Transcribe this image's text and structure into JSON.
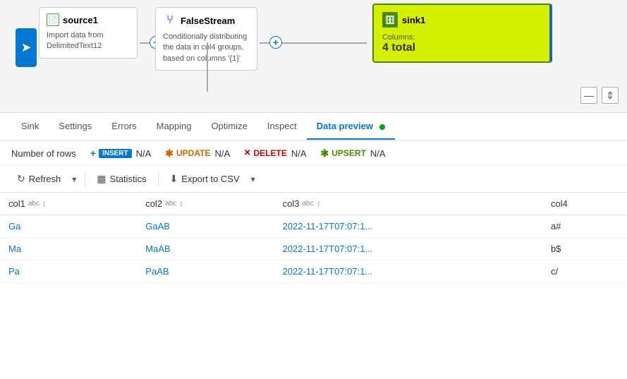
{
  "canvas": {
    "source": {
      "name": "source1",
      "description": "Import data from DelimitedText12"
    },
    "falseStream": {
      "name": "FalseStream",
      "description": "Conditionally distributing the data in col4 groups, based on columns '{1}'"
    },
    "sink": {
      "name": "sink1",
      "columns_label": "Columns:",
      "columns_value": "4 total"
    }
  },
  "tabs": [
    {
      "label": "Sink",
      "active": false
    },
    {
      "label": "Settings",
      "active": false
    },
    {
      "label": "Errors",
      "active": false
    },
    {
      "label": "Mapping",
      "active": false
    },
    {
      "label": "Optimize",
      "active": false
    },
    {
      "label": "Inspect",
      "active": false
    },
    {
      "label": "Data preview",
      "active": true
    }
  ],
  "summary": {
    "rows_label": "Number of rows",
    "insert_badge": "INSERT",
    "insert_value": "N/A",
    "update_symbol": "✱",
    "update_badge": "UPDATE",
    "update_value": "N/A",
    "delete_symbol": "×",
    "delete_badge": "DELETE",
    "delete_value": "N/A",
    "upsert_symbol": "✱",
    "upsert_badge": "UPSERT",
    "upsert_value": "N/A"
  },
  "toolbar": {
    "refresh_label": "Refresh",
    "statistics_label": "Statistics",
    "export_label": "Export to CSV"
  },
  "table": {
    "columns": [
      {
        "name": "col1",
        "type": "abc"
      },
      {
        "name": "col2",
        "type": "abc"
      },
      {
        "name": "col3",
        "type": "abc"
      },
      {
        "name": "col4",
        "type": ""
      }
    ],
    "rows": [
      {
        "col1": "Ga",
        "col2": "GaAB",
        "col3": "2022-11-17T07:07:1...",
        "col4": "a#"
      },
      {
        "col1": "Ma",
        "col2": "MaAB",
        "col3": "2022-11-17T07:07:1...",
        "col4": "b$"
      },
      {
        "col1": "Pa",
        "col2": "PaAB",
        "col3": "2022-11-17T07:07:1...",
        "col4": "c/"
      }
    ]
  }
}
